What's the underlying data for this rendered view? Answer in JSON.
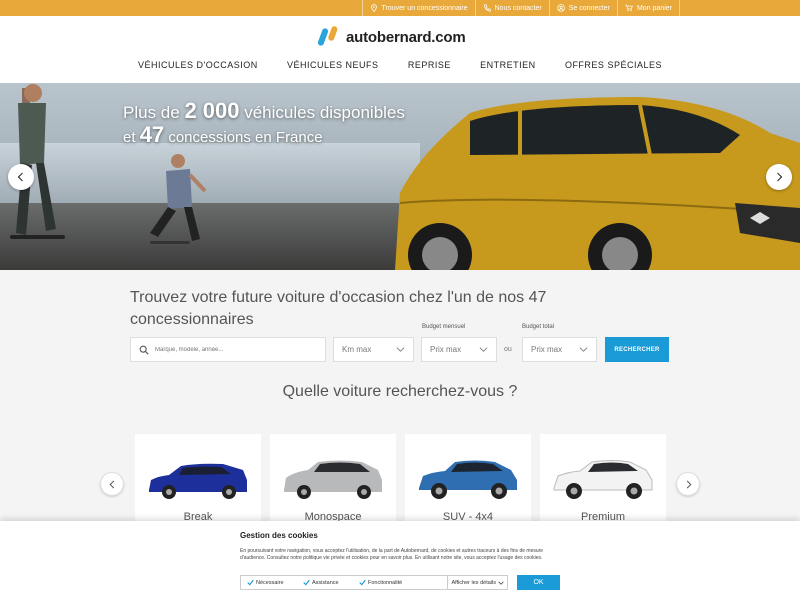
{
  "topbar": {
    "links": [
      {
        "label": "Trouver un concessionnaire",
        "icon": "location-pin-icon"
      },
      {
        "label": "Nous contacter",
        "icon": "phone-icon"
      },
      {
        "label": "Se connecter",
        "icon": "user-icon"
      },
      {
        "label": "Mon panier",
        "icon": "cart-icon"
      }
    ]
  },
  "header": {
    "logo_text": "autobernard.com",
    "nav": [
      "VÉHICULES D'OCCASION",
      "VÉHICULES NEUFS",
      "REPRISE",
      "ENTRETIEN",
      "OFFRES SPÉCIALES"
    ]
  },
  "hero": {
    "line1_prefix": "Plus de ",
    "line1_number": "2 000",
    "line1_suffix": " véhicules disponibles",
    "line2_prefix": "et ",
    "line2_number": "47",
    "line2_suffix": " concessions en France"
  },
  "search": {
    "title": "Trouvez votre future voiture d'occasion chez l'un de nos 47 concessionnaires",
    "placeholder": "Marque, modèle, année...",
    "km_select": "Km max",
    "budget_monthly_label": "Budget mensuel",
    "budget_monthly_select": "Prix max",
    "ou": "ou",
    "budget_total_label": "Budget total",
    "budget_total_select": "Prix max",
    "button": "RECHERCHER"
  },
  "categories": {
    "title": "Quelle voiture recherchez-vous ?",
    "items": [
      {
        "label": "Break",
        "color": "#1c2f9a"
      },
      {
        "label": "Monospace",
        "color": "#b8b9bb"
      },
      {
        "label": "SUV - 4x4",
        "color": "#2f6fb1"
      },
      {
        "label": "Premium",
        "color": "#f3f3f3"
      }
    ]
  },
  "cookie": {
    "title": "Gestion des cookies",
    "text": "En poursuivant votre navigation, vous acceptez l'utilisation, de la part de Autobernard, de cookies et autres traceurs à des fins de mesure d'audience. Consultez notre politique vie privée et cookies pour en savoir plus. En utilisant notre site, vous acceptez l'usage des cookies.",
    "options": [
      "Nécessaire",
      "Assistance",
      "Fonctionnalité"
    ],
    "details": "Afficher les détails",
    "ok": "OK"
  },
  "colors": {
    "topbar": "#e8a93a",
    "accent": "#1a9ad6",
    "hero_car": "#c79a1e"
  }
}
